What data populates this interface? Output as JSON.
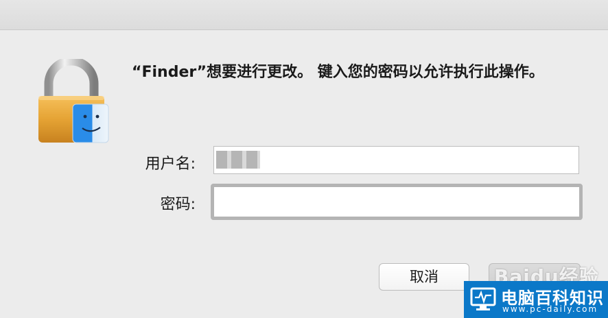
{
  "dialog": {
    "message": "“Finder”想要进行更改。 键入您的密码以允许执行此操作。",
    "username_label": "用户名:",
    "username_value": "",
    "password_label": "密码:",
    "password_value": "",
    "cancel_label": "取消",
    "ok_label": ""
  },
  "watermark": {
    "baidu_text": "Baidu经验",
    "site_name": "电脑百科知识",
    "site_url": "www.pc-daily.com"
  },
  "colors": {
    "window_bg": "#ececec",
    "watermark_bg": "#0b78c8"
  }
}
